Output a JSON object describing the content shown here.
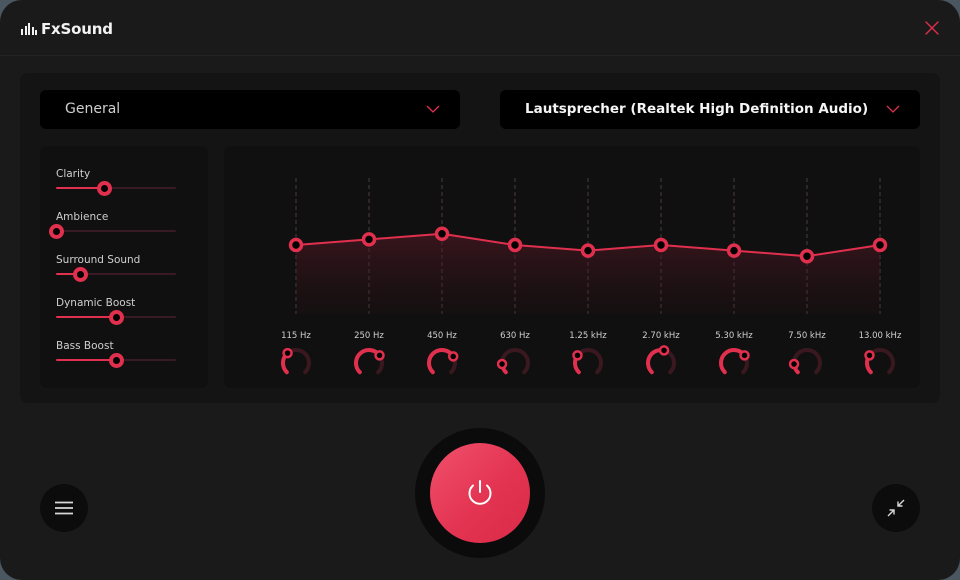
{
  "app": {
    "title": "FxSound",
    "accent_color": "#e0304e",
    "close_icon": "close-icon"
  },
  "dropdowns": {
    "preset": {
      "selected": "General",
      "icon": "chevron-down-icon"
    },
    "device": {
      "selected": "Lautsprecher (Realtek High Definition Audio)",
      "icon": "chevron-down-icon"
    }
  },
  "effects": [
    {
      "name": "Clarity",
      "value_percent": 40
    },
    {
      "name": "Ambience",
      "value_percent": 0
    },
    {
      "name": "Surround Sound",
      "value_percent": 20
    },
    {
      "name": "Dynamic Boost",
      "value_percent": 50
    },
    {
      "name": "Bass Boost",
      "value_percent": 50
    }
  ],
  "equalizer": {
    "gain_range_db": [
      -12,
      12
    ],
    "bands": [
      {
        "label": "115 Hz",
        "gain_db": 0,
        "knob_percent": 35
      },
      {
        "label": "250 Hz",
        "gain_db": 1,
        "knob_percent": 70
      },
      {
        "label": "450 Hz",
        "gain_db": 2,
        "knob_percent": 72
      },
      {
        "label": "630 Hz",
        "gain_db": 0,
        "knob_percent": 15
      },
      {
        "label": "1.25 kHz",
        "gain_db": -1,
        "knob_percent": 30
      },
      {
        "label": "2.70 kHz",
        "gain_db": 0,
        "knob_percent": 55
      },
      {
        "label": "5.30 kHz",
        "gain_db": -1,
        "knob_percent": 70
      },
      {
        "label": "7.50 kHz",
        "gain_db": -2,
        "knob_percent": 15
      },
      {
        "label": "13.00 kHz",
        "gain_db": 0,
        "knob_percent": 30
      }
    ]
  },
  "controls": {
    "menu_icon": "hamburger-menu-icon",
    "power_icon": "power-icon",
    "power_on": true,
    "minimize_icon": "collapse-arrows-icon"
  }
}
